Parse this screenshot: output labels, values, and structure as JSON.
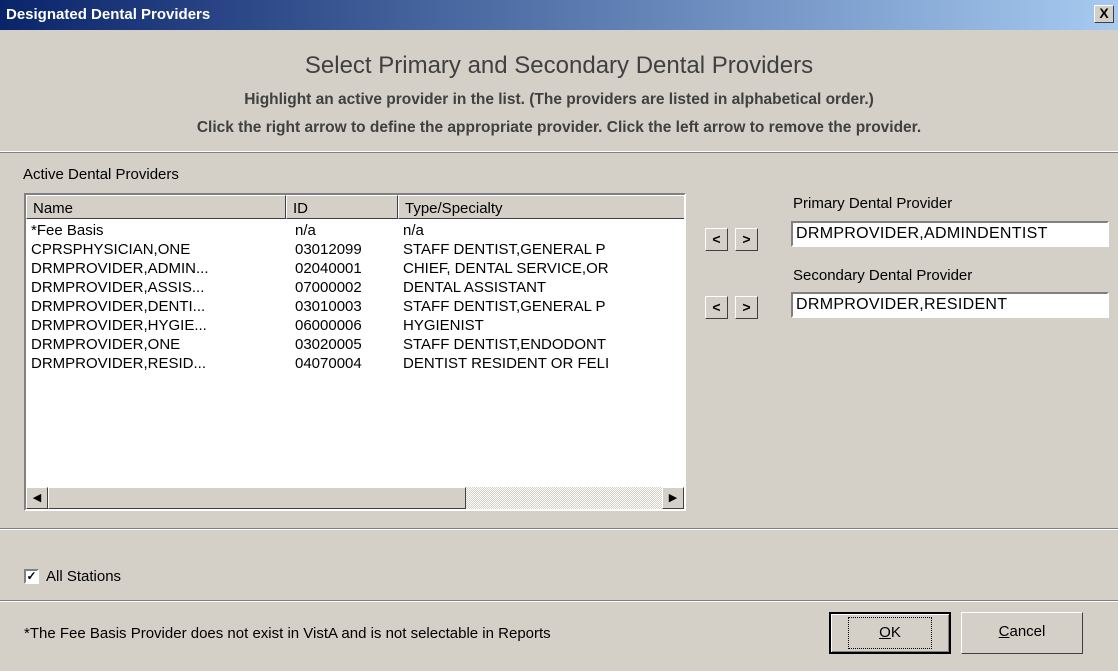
{
  "window": {
    "title": "Designated Dental Providers",
    "close_label": "X"
  },
  "header": {
    "heading": "Select Primary and Secondary Dental Providers",
    "instruction_1": "Highlight an active provider in the list.  (The providers are listed in alphabetical order.)",
    "instruction_2": "Click the right arrow to define the appropriate provider.  Click the left arrow to remove the provider."
  },
  "providers": {
    "label": "Active Dental Providers",
    "columns": [
      "Name",
      "ID",
      "Type/Specialty"
    ],
    "rows": [
      [
        "*Fee Basis",
        "n/a",
        "n/a"
      ],
      [
        "CPRSPHYSICIAN,ONE",
        "03012099",
        "STAFF DENTIST,GENERAL P"
      ],
      [
        "DRMPROVIDER,ADMIN...",
        "02040001",
        "CHIEF, DENTAL SERVICE,OR"
      ],
      [
        "DRMPROVIDER,ASSIS...",
        "07000002",
        "DENTAL ASSISTANT"
      ],
      [
        "DRMPROVIDER,DENTI...",
        "03010003",
        "STAFF DENTIST,GENERAL P"
      ],
      [
        "DRMPROVIDER,HYGIE...",
        "06000006",
        "HYGIENIST"
      ],
      [
        "DRMPROVIDER,ONE",
        "03020005",
        "STAFF DENTIST,ENDODONT"
      ],
      [
        "DRMPROVIDER,RESID...",
        "04070004",
        "DENTIST RESIDENT OR FELI"
      ]
    ],
    "scroll_left": "◀",
    "scroll_right": "▶"
  },
  "primary": {
    "label": "Primary Dental Provider",
    "value": "DRMPROVIDER,ADMINDENTIST",
    "remove": "<",
    "add": ">"
  },
  "secondary": {
    "label": "Secondary Dental Provider",
    "value": "DRMPROVIDER,RESIDENT",
    "remove": "<",
    "add": ">"
  },
  "all_stations": {
    "label": "All Stations",
    "checked": true,
    "mark": "✓"
  },
  "footer": {
    "note": "*The Fee Basis Provider does not exist in VistA and is not selectable in Reports",
    "ok_label": "OK",
    "cancel_label": "Cancel"
  }
}
